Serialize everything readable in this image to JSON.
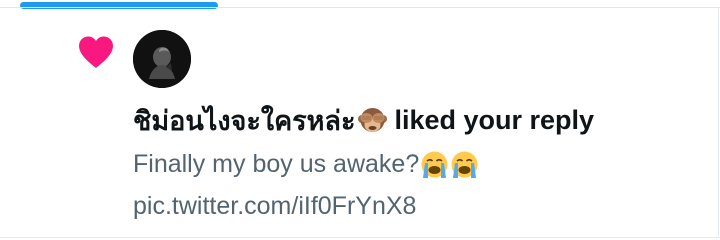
{
  "notification": {
    "type_icon": "heart-icon",
    "accent_color": "#f91880",
    "progress_color": "#1d9bf0",
    "user": {
      "display_name": "ชิม่อนไงจะใครหล่ะ",
      "name_emoji": "see-no-evil-monkey-icon",
      "avatar": "avatar"
    },
    "action_text": "liked your reply",
    "tweet": {
      "text": "Finally my boy us awake?",
      "emojis": [
        "crying-face-icon",
        "crying-face-icon"
      ],
      "link": "pic.twitter.com/iIf0FrYnX8"
    }
  }
}
